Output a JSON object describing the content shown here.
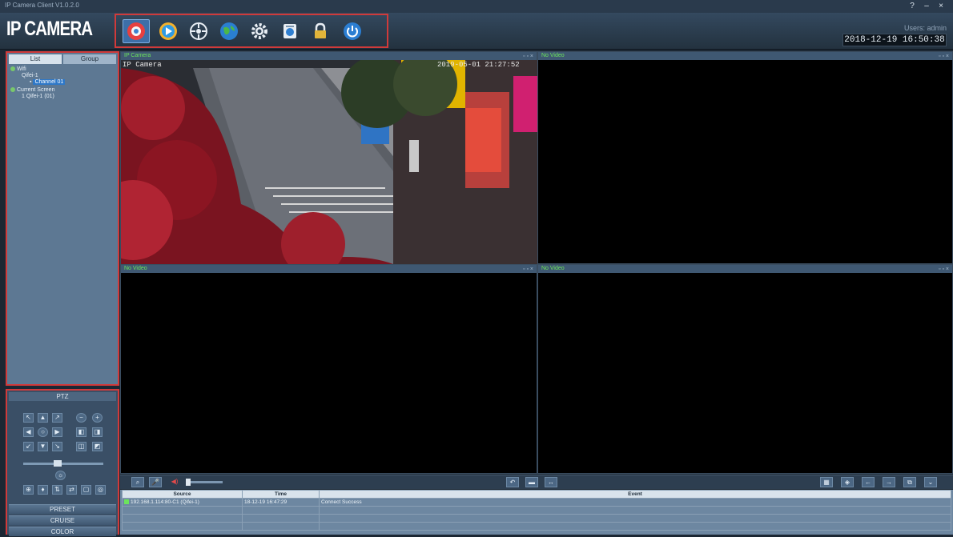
{
  "window": {
    "title": "IP Camera Client V1.0.2.0",
    "controls": [
      "?",
      "–",
      "×"
    ]
  },
  "header": {
    "logo": "IP CAMERA",
    "user": "Users: admin",
    "datetime": "2018-12-19 16:50:38",
    "tools": [
      {
        "name": "live-view-icon"
      },
      {
        "name": "playback-icon"
      },
      {
        "name": "ptz-control-icon"
      },
      {
        "name": "network-globe-icon"
      },
      {
        "name": "settings-gear-icon"
      },
      {
        "name": "local-record-icon"
      },
      {
        "name": "lock-icon"
      },
      {
        "name": "power-icon"
      }
    ]
  },
  "left_panel": {
    "tabs": [
      "List",
      "Group"
    ],
    "tree": [
      {
        "label": "Wifi",
        "level": 0
      },
      {
        "label": "Qifei-1",
        "level": 1
      },
      {
        "label": "Channel 01",
        "level": 2,
        "selected": true
      },
      {
        "label": "Current Screen",
        "level": 0
      },
      {
        "label": "1 Qifei-1 (01)",
        "level": 1
      }
    ]
  },
  "ptz": {
    "title": "PTZ",
    "preset": "PRESET",
    "cruise": "CRUISE",
    "color": "COLOR",
    "marker": "C"
  },
  "video": {
    "cells": [
      {
        "status": "IP Camera",
        "feed_label": "IP Camera",
        "timestamp": "2019-05-01 21:27:52"
      },
      {
        "status": "No Video"
      },
      {
        "status": "No Video"
      },
      {
        "status": "No Video"
      }
    ]
  },
  "log": {
    "headers": [
      "Source",
      "Time",
      "Event"
    ],
    "rows": [
      [
        "192.168.1.114:80-C1 (Qifei-1)",
        "18-12-19 16:47:29",
        "Connect Success"
      ],
      [
        "",
        "",
        ""
      ],
      [
        "",
        "",
        ""
      ],
      [
        "",
        "",
        ""
      ]
    ]
  },
  "colors": {
    "highlight_box": "#d03a3a",
    "status_green": "#6ce35c",
    "panel": "#5d7893"
  }
}
